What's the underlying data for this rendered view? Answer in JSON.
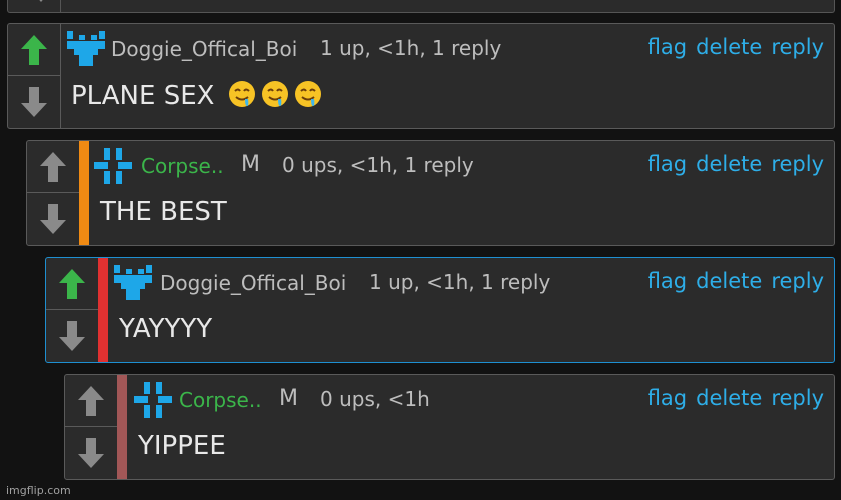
{
  "colors": {
    "background": "#121212",
    "card": "#2b2b2b",
    "upvoted_arrow": "#3bb54a",
    "neutral_arrow": "#8a8a8a",
    "action_link": "#2eaee8",
    "username_green": "#3bb54a",
    "username_grey": "#bdbdbd",
    "depth_orange": "#f08a13",
    "depth_red": "#e03131",
    "depth_maroon": "#a25757",
    "selected_border": "#1e8fd0"
  },
  "actions": {
    "flag": "flag",
    "delete": "delete",
    "reply": "reply"
  },
  "comments": [
    {
      "username": "Doggie_Offical_Boi",
      "meta": "1 up, <1h, 1 reply",
      "text": "PLANE SEX",
      "emojis": [
        "drooling-face",
        "drooling-face",
        "drooling-face"
      ],
      "upvoted": true,
      "avatar": "doggie-avatar-icon"
    },
    {
      "username": "Corpse..",
      "badge": "M",
      "meta": "0 ups, <1h, 1 reply",
      "text": "THE BEST",
      "upvoted": false,
      "avatar": "corpse-avatar-icon"
    },
    {
      "username": "Doggie_Offical_Boi",
      "meta": "1 up, <1h, 1 reply",
      "text": "YAYYYY",
      "upvoted": true,
      "avatar": "doggie-avatar-icon"
    },
    {
      "username": "Corpse..",
      "badge": "M",
      "meta": "0 ups, <1h",
      "text": "YIPPEE",
      "upvoted": false,
      "avatar": "corpse-avatar-icon"
    }
  ],
  "watermark": "imgflip.com"
}
